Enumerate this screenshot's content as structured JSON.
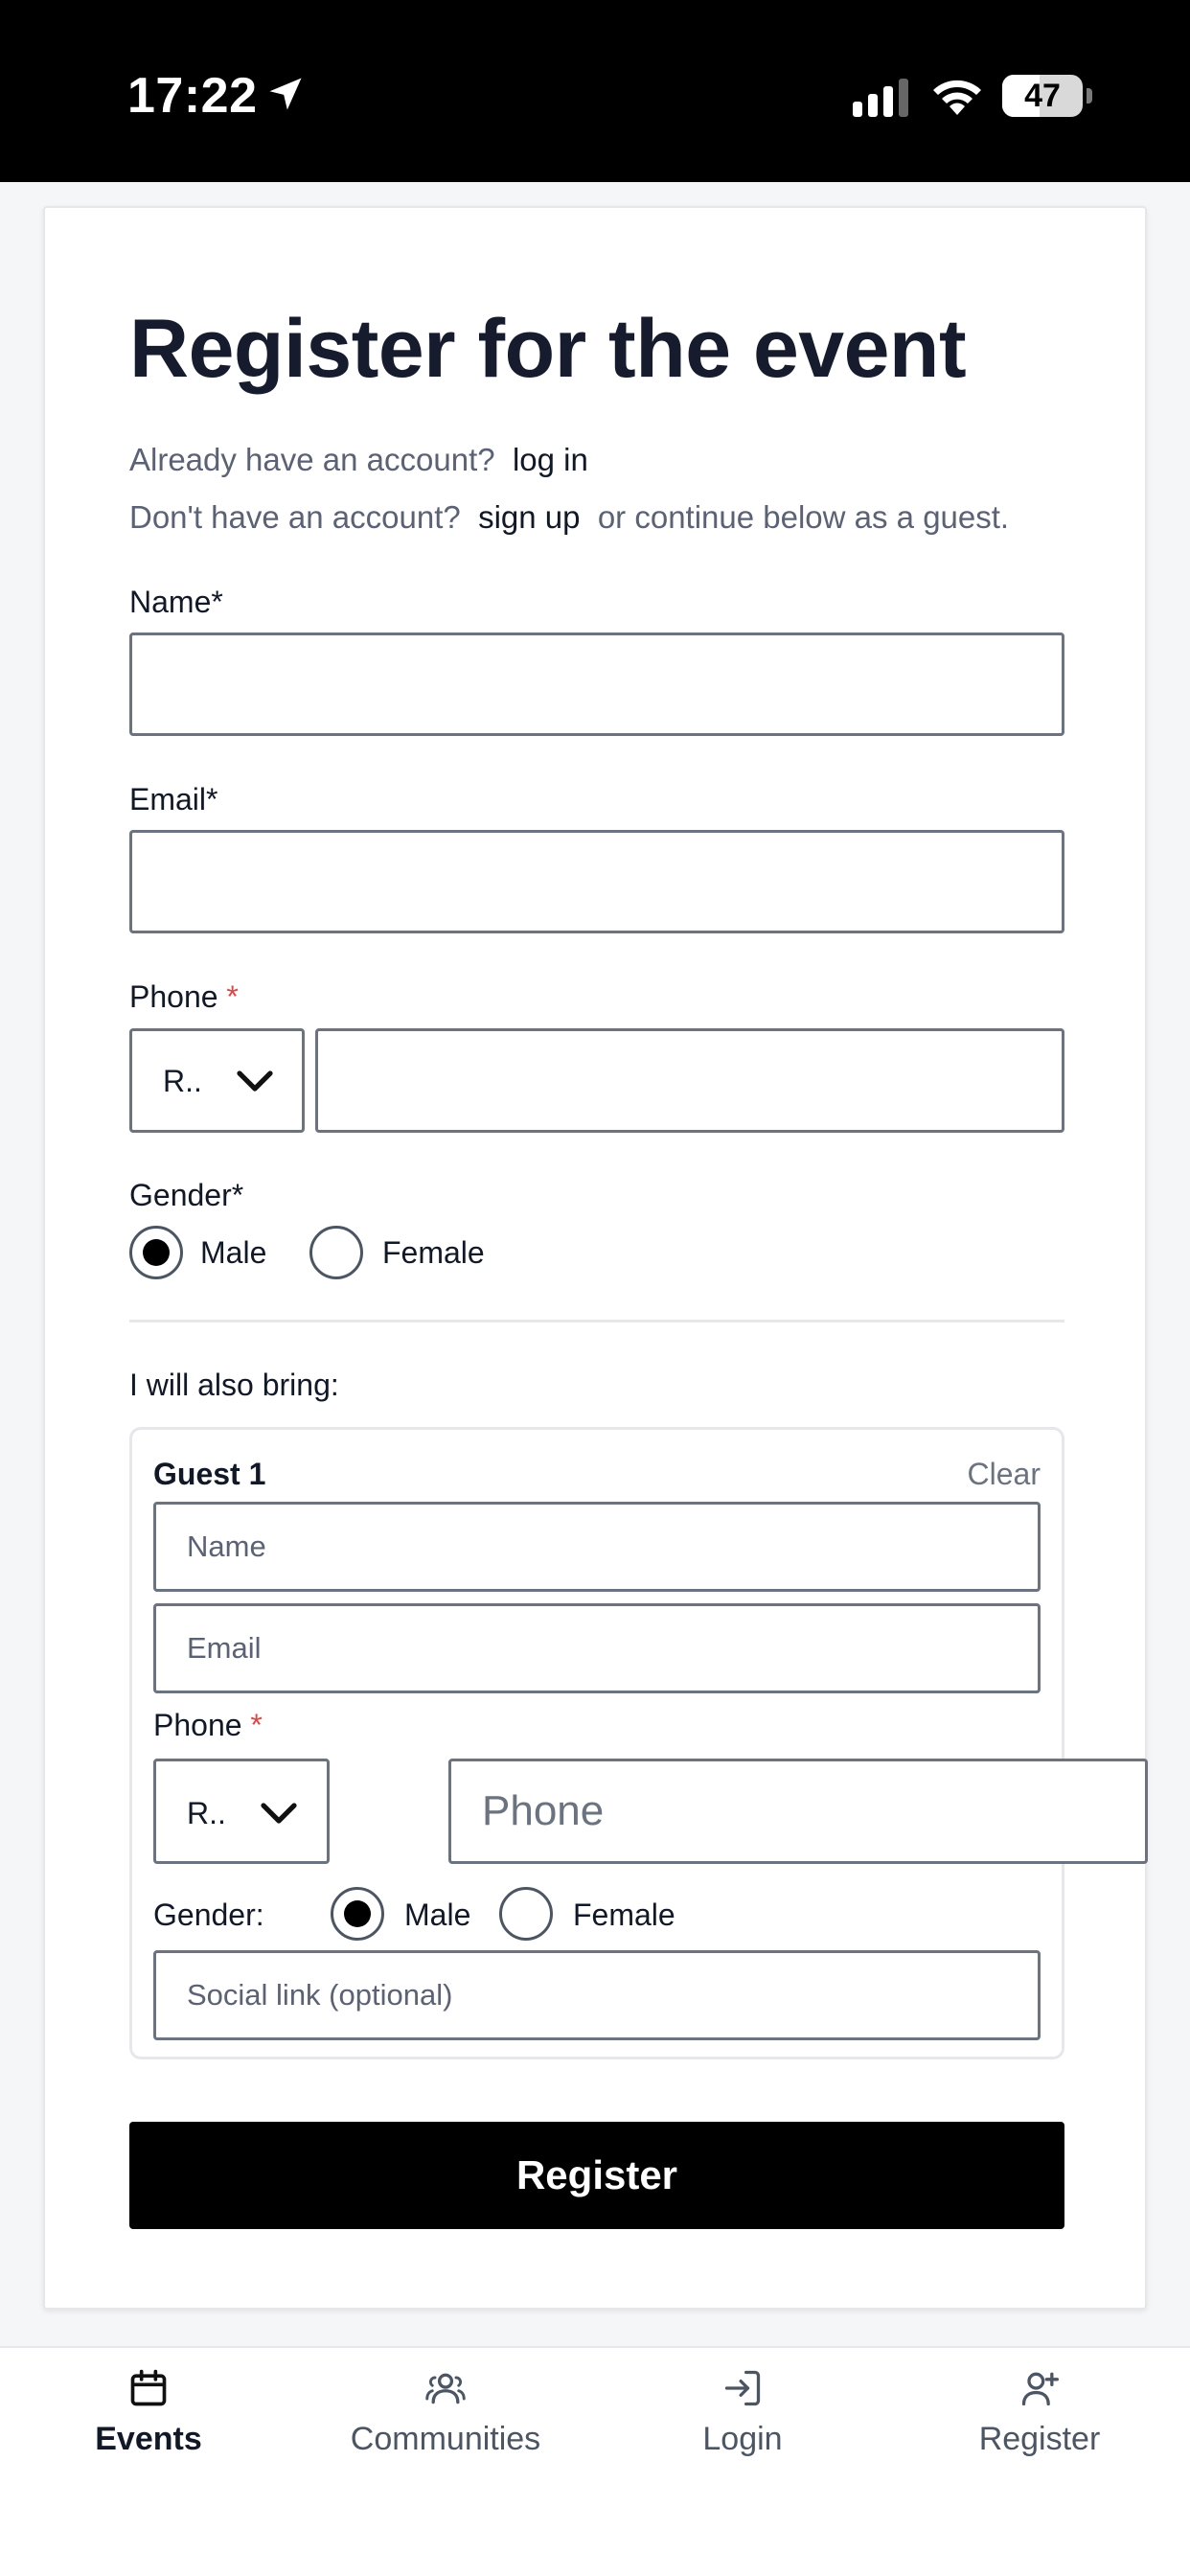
{
  "status_bar": {
    "time": "17:22",
    "battery": "47",
    "battery_level": 0.47
  },
  "form": {
    "title": "Register for the event",
    "already_text": "Already have an account?",
    "login_link": "log in",
    "dont_text": "Don't have an account?",
    "signup_link": "sign up",
    "continue_text": "or continue below as a guest.",
    "name_label": "Name*",
    "email_label": "Email*",
    "phone_label": "Phone",
    "required_mark": "*",
    "country_code": "R..",
    "gender_label": "Gender*",
    "male_label": "Male",
    "female_label": "Female",
    "selected_gender": "Male",
    "bring_label": "I will also bring:",
    "register_button": "Register"
  },
  "guest": {
    "title": "Guest 1",
    "clear": "Clear",
    "name_placeholder": "Name",
    "email_placeholder": "Email",
    "phone_label": "Phone",
    "required_mark": "*",
    "country_code": "R..",
    "phone_placeholder": "Phone",
    "gender_label": "Gender:",
    "male_label": "Male",
    "female_label": "Female",
    "selected_gender": "Male",
    "social_placeholder": "Social link (optional)"
  },
  "nav": {
    "items": [
      {
        "label": "Events",
        "icon": "calendar-icon",
        "active": true
      },
      {
        "label": "Communities",
        "icon": "users-icon",
        "active": false
      },
      {
        "label": "Login",
        "icon": "login-icon",
        "active": false
      },
      {
        "label": "Register",
        "icon": "user-plus-icon",
        "active": false
      }
    ]
  },
  "colors": {
    "accent": "#000000",
    "required": "#e04545",
    "muted_text": "#5b6275"
  }
}
